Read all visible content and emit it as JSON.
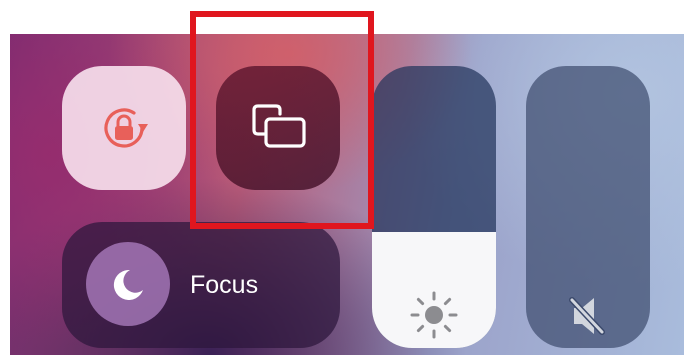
{
  "control_center": {
    "rotation_lock": {
      "icon": "rotation-lock-icon"
    },
    "screen_mirroring": {
      "icon": "screen-mirroring-icon"
    },
    "focus": {
      "label": "Focus",
      "icon": "moon-icon"
    },
    "brightness": {
      "icon": "sun-icon",
      "level": 0.41
    },
    "volume": {
      "icon": "speaker-muted-icon",
      "level": 0
    }
  },
  "annotation": {
    "highlight_color": "#e0161e"
  },
  "colors": {
    "rotation_tile": "#f6deec",
    "rotation_icon": "#e8605a",
    "focus_circle": "#b082c4"
  }
}
